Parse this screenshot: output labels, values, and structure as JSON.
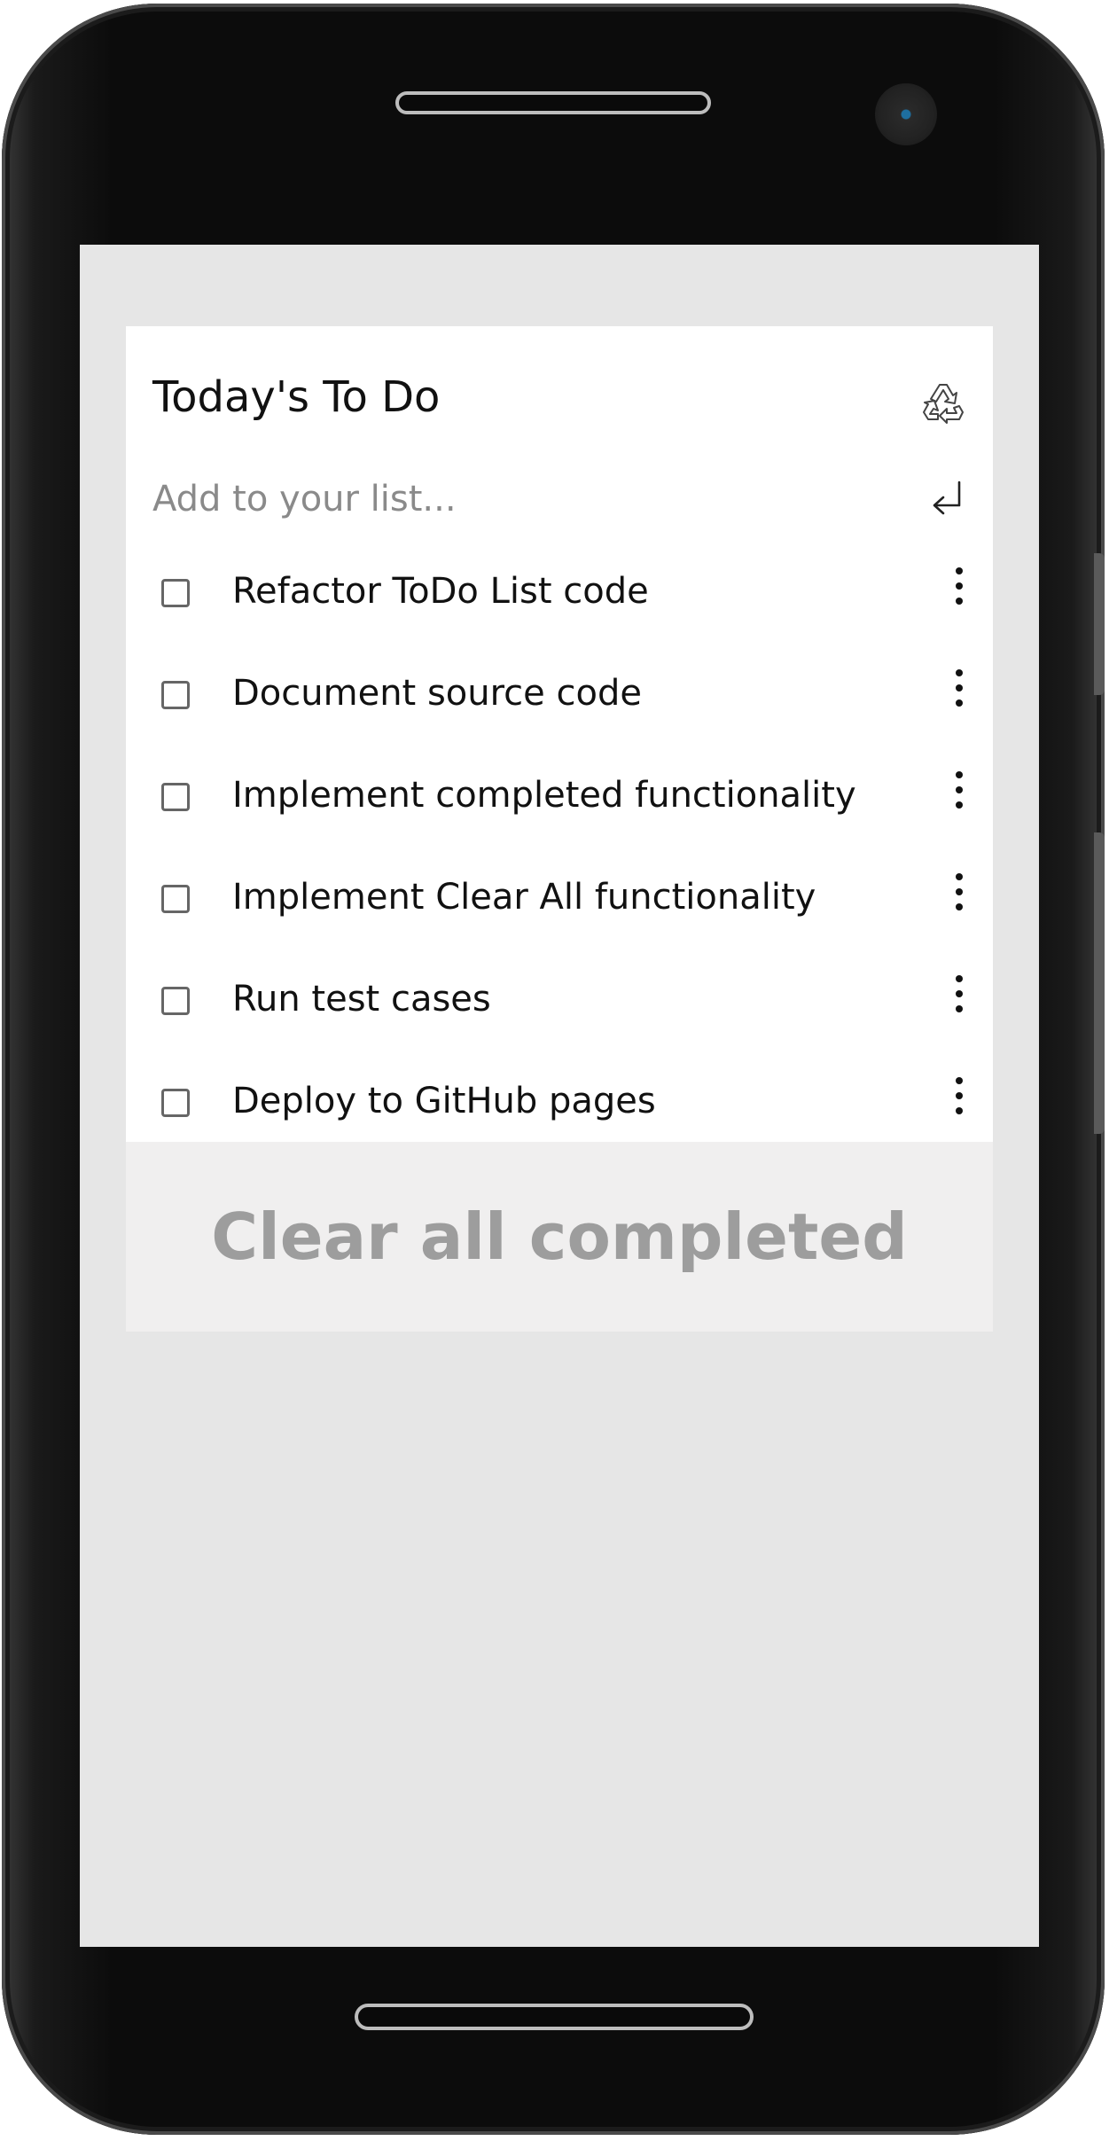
{
  "app": {
    "title": "Today's To Do"
  },
  "add": {
    "placeholder": "Add to your list..."
  },
  "todos": [
    {
      "label": "Refactor ToDo List code",
      "checked": false
    },
    {
      "label": "Document source code",
      "checked": false
    },
    {
      "label": "Implement completed functionality",
      "checked": false
    },
    {
      "label": "Implement Clear All functionality",
      "checked": false
    },
    {
      "label": "Run test cases",
      "checked": false
    },
    {
      "label": "Deploy to GitHub pages",
      "checked": false
    }
  ],
  "actions": {
    "clear_completed_label": "Clear all completed"
  },
  "icons": {
    "header": "recycle-icon",
    "add": "enter-icon",
    "item_menu": "more-vertical-icon"
  },
  "colors": {
    "screen_background": "#e6e6e6",
    "card_background": "#ffffff",
    "clear_button_background": "#f0efef",
    "clear_button_text": "#9d9d9d",
    "placeholder_text": "#8a8a8a"
  }
}
